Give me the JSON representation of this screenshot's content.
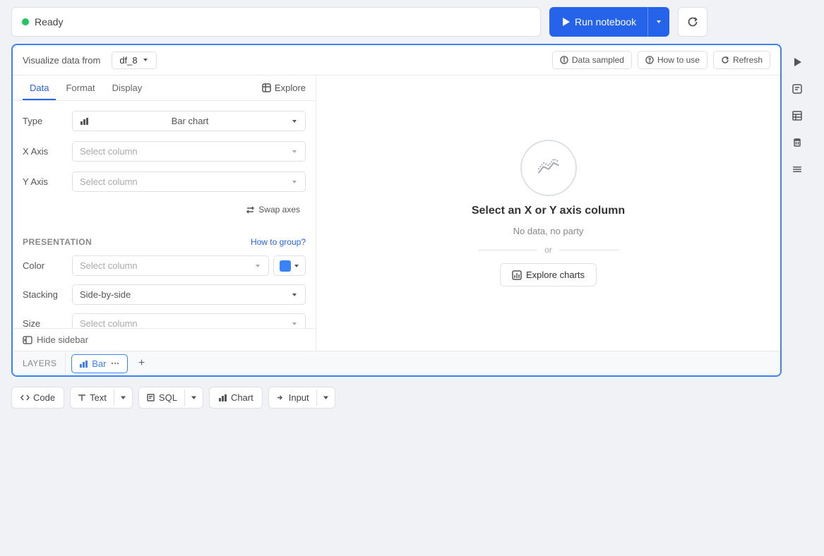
{
  "status": {
    "dot_color": "#22c55e",
    "label": "Ready"
  },
  "run_button": {
    "label": "Run notebook",
    "caret": "▾"
  },
  "cell": {
    "visualize_label": "Visualize data from",
    "df_value": "df_8",
    "data_sampled_label": "Data sampled",
    "how_to_use_label": "How to use",
    "refresh_label": "Refresh"
  },
  "sidebar_tabs": {
    "tabs": [
      {
        "label": "Data",
        "active": true
      },
      {
        "label": "Format",
        "active": false
      },
      {
        "label": "Display",
        "active": false
      }
    ],
    "explore_label": "Explore"
  },
  "form": {
    "type_label": "Type",
    "type_value": "Bar chart",
    "x_axis_label": "X Axis",
    "x_axis_placeholder": "Select column",
    "y_axis_label": "Y Axis",
    "y_axis_placeholder": "Select column",
    "swap_axes_label": "Swap axes"
  },
  "presentation": {
    "title": "PRESENTATION",
    "how_to_group_label": "How to group?",
    "color_label": "Color",
    "color_placeholder": "Select column",
    "stacking_label": "Stacking",
    "stacking_value": "Side-by-side",
    "size_label": "Size",
    "size_placeholder": "Select column"
  },
  "hide_sidebar_label": "Hide sidebar",
  "chart_empty": {
    "title": "Select an X or Y axis column",
    "subtitle": "No data, no party",
    "or_text": "or",
    "explore_charts_label": "Explore charts"
  },
  "layers": {
    "label": "LAYERS",
    "tabs": [
      {
        "label": "Bar",
        "icon": "bar-chart"
      }
    ],
    "add_icon": "+"
  },
  "right_sidebar_icons": [
    "play",
    "text",
    "table",
    "trash",
    "menu"
  ],
  "bottom_toolbar": {
    "code_label": "Code",
    "text_label": "Text",
    "sql_label": "SQL",
    "chart_label": "Chart",
    "input_label": "Input"
  }
}
